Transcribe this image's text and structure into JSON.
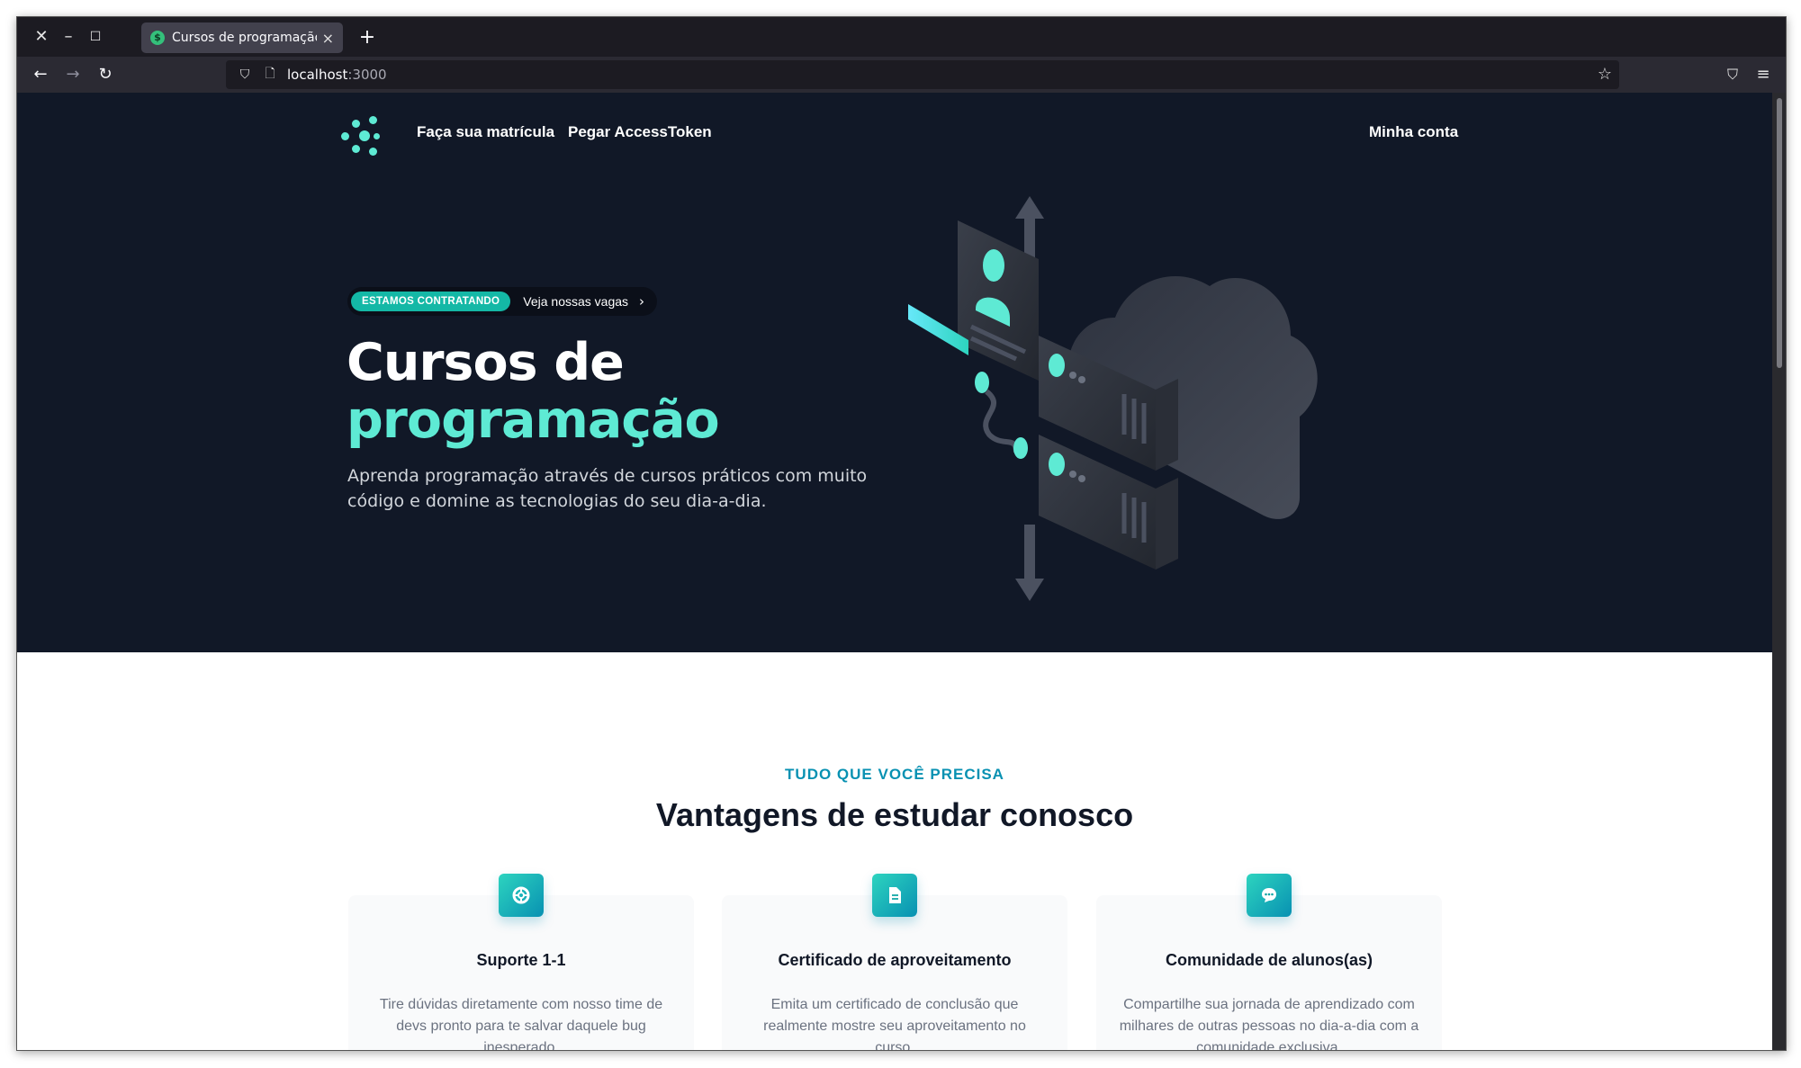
{
  "browser": {
    "tab_title": "Cursos de programação",
    "favicon_glyph": "$",
    "url_host": "localhost",
    "url_port": ":3000"
  },
  "nav": {
    "links": [
      "Faça sua matrícula",
      "Pegar AccessToken"
    ],
    "account": "Minha conta"
  },
  "hero": {
    "badge_pill": "ESTAMOS CONTRATANDO",
    "badge_text": "Veja nossas vagas",
    "title_line1": "Cursos de",
    "title_line2": "programação",
    "subtitle": "Aprenda programação através de cursos práticos com muito código e domine as tecnologias do seu dia-a-dia."
  },
  "features": {
    "eyebrow": "TUDO QUE VOCÊ PRECISA",
    "title": "Vantagens de estudar conosco",
    "cards": [
      {
        "icon": "lifebuoy-icon",
        "title": "Suporte 1-1",
        "text": "Tire dúvidas diretamente com nosso time de devs pronto para te salvar daquele bug inesperado."
      },
      {
        "icon": "document-icon",
        "title": "Certificado de aproveitamento",
        "text": "Emita um certificado de conclusão que realmente mostre seu aproveitamento no curso."
      },
      {
        "icon": "chat-icon",
        "title": "Comunidade de alunos(as)",
        "text": "Compartilhe sua jornada de aprendizado com milhares de outras pessoas no dia-a-dia com a comunidade exclusiva."
      }
    ]
  },
  "colors": {
    "hero_bg": "#111827",
    "accent": "#5eead4",
    "badge": "#14b8a6",
    "eyebrow": "#0891b2"
  }
}
